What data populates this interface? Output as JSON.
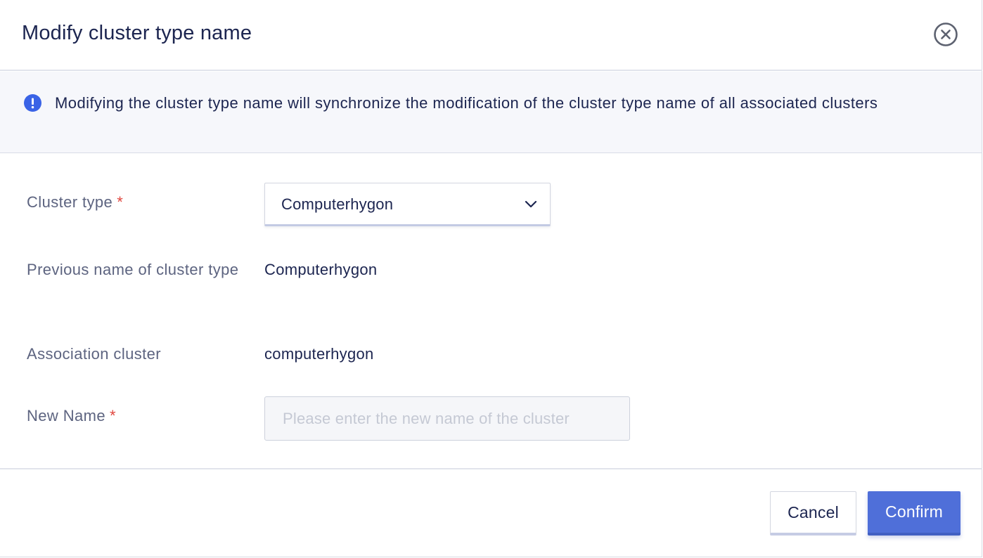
{
  "dialog": {
    "title": "Modify cluster type name",
    "close_icon": "close-circle-icon"
  },
  "alert": {
    "icon": "info-exclamation-icon",
    "color": "#3a63e6",
    "text": "Modifying the cluster type name will synchronize the modification of the cluster type name of all associated clusters"
  },
  "form": {
    "cluster_type": {
      "label": "Cluster type",
      "required_mark": "*",
      "selected_value": "Computerhygon",
      "chevron_icon": "chevron-down-icon"
    },
    "previous_name": {
      "label": "Previous name of cluster type",
      "value": "Computerhygon"
    },
    "association_cluster": {
      "label": "Association cluster",
      "value": "computerhygon"
    },
    "new_name": {
      "label": "New Name",
      "required_mark": "*",
      "value": "",
      "placeholder": "Please enter the new name of the cluster"
    }
  },
  "footer": {
    "cancel_label": "Cancel",
    "confirm_label": "Confirm",
    "confirm_color": "#4f6fd9",
    "required_color": "#e0473f"
  }
}
